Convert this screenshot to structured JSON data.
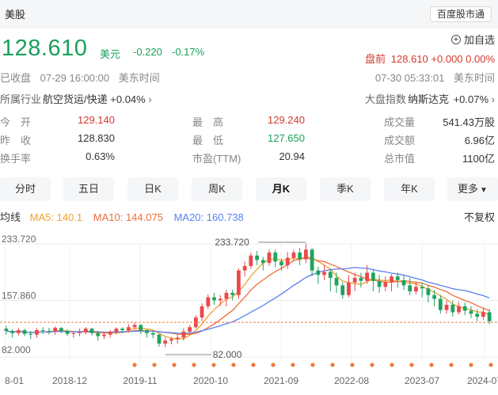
{
  "header": {
    "market_tab": "美股",
    "app_button": "百度股市通"
  },
  "quote": {
    "price": "128.610",
    "unit": "美元",
    "change": "-0.220",
    "change_pct": "-0.17%",
    "add_watchlist": "加自选",
    "premarket_label": "盘前",
    "premarket_value": "128.610 +0.000 0.00%",
    "status": "已收盘",
    "close_date": "07-29 16:00:00",
    "timezone": "美东时间",
    "now_date": "07-30 05:33:01",
    "now_timezone": "美东时间",
    "colors": {
      "down": "#1aa05b",
      "up": "#d23a2c"
    }
  },
  "industry": {
    "label": "所属行业",
    "name": "航空货运/快递",
    "change": "+0.04%"
  },
  "index": {
    "label": "大盘指数",
    "name": "纳斯达克",
    "change": "+0.07%"
  },
  "stats": {
    "open": {
      "label": "今　开",
      "value": "129.140"
    },
    "prev_close": {
      "label": "昨　收",
      "value": "128.830"
    },
    "turnover": {
      "label": "换手率",
      "value": "0.63%"
    },
    "high": {
      "label": "最　高",
      "value": "129.240"
    },
    "low": {
      "label": "最　低",
      "value": "127.650"
    },
    "pe": {
      "label": "市盈(TTM)",
      "value": "20.94"
    },
    "volume": {
      "label": "成交量",
      "value": "541.43万股"
    },
    "amount": {
      "label": "成交额",
      "value": "6.96亿"
    },
    "market_cap": {
      "label": "总市值",
      "value": "1100亿"
    }
  },
  "tabs": [
    "分时",
    "五日",
    "日K",
    "周K",
    "月K",
    "季K",
    "年K",
    "更多"
  ],
  "active_tab": "月K",
  "ma": {
    "label": "均线",
    "ma5": "MA5: 140.1",
    "ma10": "MA10: 144.075",
    "ma20": "MA20: 160.738",
    "adjust": "不复权"
  },
  "chart_data": {
    "type": "candlestick",
    "y_ticks": [
      "233.720",
      "157.860",
      "82.000"
    ],
    "ylim": [
      82.0,
      233.72
    ],
    "x_ticks": [
      "8-01",
      "2018-12",
      "2019-11",
      "2020-10",
      "2021-09",
      "2022-08",
      "2023-07",
      "2024-07"
    ],
    "max_annotation": "233.720",
    "min_annotation": "82.000",
    "last_price": 128.61,
    "series": [
      {
        "name": "MA5",
        "color": "#f0a030"
      },
      {
        "name": "MA10",
        "color": "#f06e3a"
      },
      {
        "name": "MA20",
        "color": "#5b7ff0"
      }
    ],
    "candles": [
      [
        120,
        117,
        124,
        112
      ],
      [
        117,
        114,
        119,
        108
      ],
      [
        114,
        118,
        121,
        111
      ],
      [
        118,
        113,
        120,
        110
      ],
      [
        113,
        112,
        117,
        106
      ],
      [
        112,
        118,
        121,
        108
      ],
      [
        118,
        117,
        122,
        113
      ],
      [
        117,
        116,
        121,
        112
      ],
      [
        116,
        121,
        123,
        112
      ],
      [
        121,
        117,
        122,
        114
      ],
      [
        117,
        113,
        119,
        110
      ],
      [
        113,
        114,
        117,
        108
      ],
      [
        114,
        115,
        120,
        110
      ],
      [
        115,
        120,
        122,
        112
      ],
      [
        120,
        114,
        121,
        111
      ],
      [
        114,
        110,
        117,
        104
      ],
      [
        110,
        112,
        116,
        106
      ],
      [
        112,
        116,
        118,
        108
      ],
      [
        116,
        120,
        122,
        112
      ],
      [
        120,
        118,
        122,
        114
      ],
      [
        118,
        122,
        126,
        115
      ],
      [
        122,
        125,
        128,
        119
      ],
      [
        125,
        118,
        126,
        113
      ],
      [
        118,
        114,
        119,
        108
      ],
      [
        114,
        112,
        117,
        107
      ],
      [
        112,
        100,
        113,
        96
      ],
      [
        100,
        104,
        108,
        95
      ],
      [
        104,
        106,
        109,
        99
      ],
      [
        106,
        108,
        112,
        100
      ],
      [
        108,
        116,
        121,
        104
      ],
      [
        116,
        122,
        125,
        112
      ],
      [
        122,
        135,
        138,
        120
      ],
      [
        135,
        150,
        154,
        130
      ],
      [
        150,
        162,
        166,
        146
      ],
      [
        162,
        158,
        168,
        152
      ],
      [
        158,
        160,
        165,
        150
      ],
      [
        160,
        168,
        172,
        150
      ],
      [
        168,
        165,
        172,
        158
      ],
      [
        165,
        198,
        201,
        160
      ],
      [
        198,
        204,
        210,
        190
      ],
      [
        204,
        218,
        222,
        200
      ],
      [
        218,
        212,
        224,
        205
      ],
      [
        212,
        208,
        216,
        198
      ],
      [
        208,
        222,
        226,
        204
      ],
      [
        222,
        210,
        226,
        202
      ],
      [
        210,
        205,
        214,
        198
      ],
      [
        205,
        215,
        223,
        200
      ],
      [
        215,
        222,
        226,
        210
      ],
      [
        222,
        213,
        228,
        205
      ],
      [
        213,
        226,
        234,
        208
      ],
      [
        226,
        198,
        228,
        190
      ],
      [
        198,
        192,
        203,
        180
      ],
      [
        192,
        196,
        205,
        185
      ],
      [
        196,
        188,
        200,
        170
      ],
      [
        188,
        178,
        195,
        168
      ],
      [
        178,
        165,
        182,
        160
      ],
      [
        165,
        182,
        192,
        162
      ],
      [
        182,
        188,
        195,
        170
      ],
      [
        188,
        184,
        195,
        175
      ],
      [
        184,
        195,
        205,
        180
      ],
      [
        195,
        184,
        200,
        170
      ],
      [
        184,
        176,
        192,
        168
      ],
      [
        176,
        182,
        190,
        170
      ],
      [
        182,
        190,
        193,
        170
      ],
      [
        190,
        185,
        195,
        175
      ],
      [
        185,
        178,
        192,
        172
      ],
      [
        178,
        170,
        188,
        165
      ],
      [
        170,
        176,
        183,
        166
      ],
      [
        176,
        174,
        182,
        162
      ],
      [
        174,
        165,
        178,
        155
      ],
      [
        165,
        160,
        172,
        150
      ],
      [
        160,
        145,
        165,
        140
      ],
      [
        145,
        152,
        158,
        140
      ],
      [
        152,
        142,
        158,
        136
      ],
      [
        142,
        150,
        156,
        139
      ],
      [
        150,
        144,
        155,
        138
      ],
      [
        144,
        140,
        150,
        134
      ],
      [
        140,
        136,
        146,
        130
      ],
      [
        136,
        142,
        148,
        132
      ],
      [
        142,
        130,
        146,
        126
      ]
    ]
  }
}
